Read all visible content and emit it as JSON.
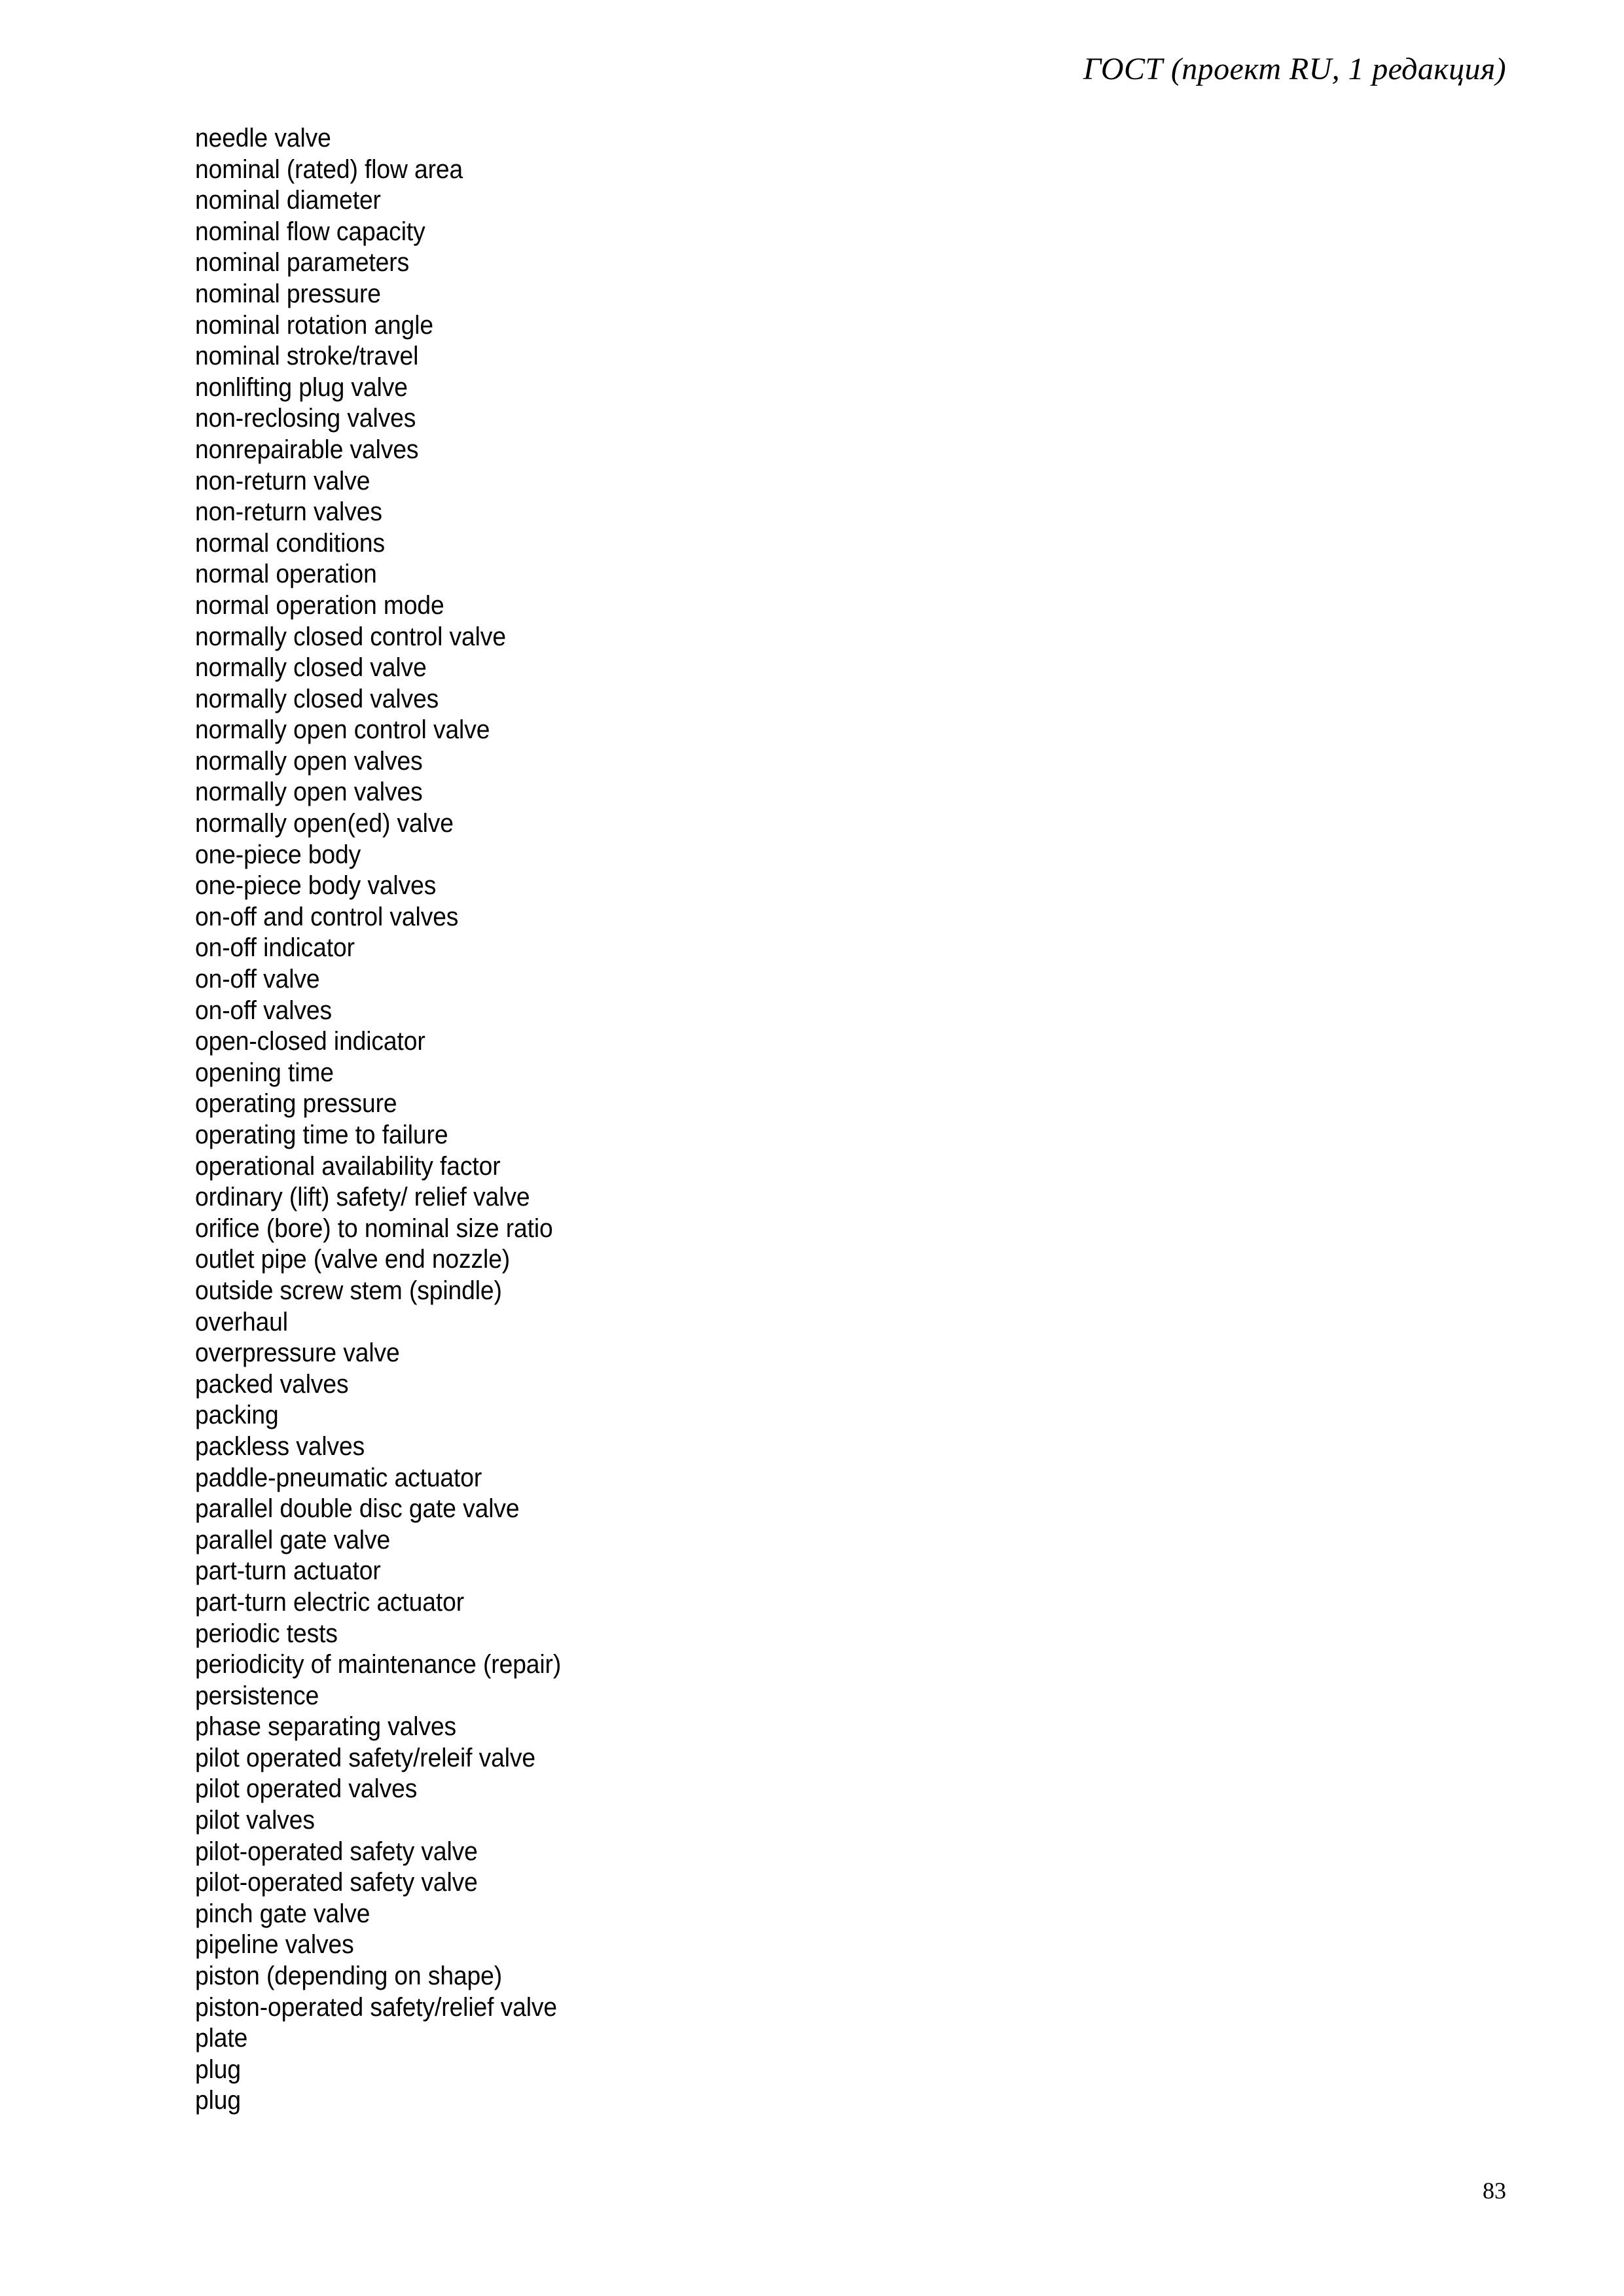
{
  "document": {
    "header_text": "ГОСТ  (проект RU, 1 редакция)",
    "page_number": "83"
  },
  "glossary": {
    "terms": [
      "needle valve",
      "nominal (rated) flow area",
      "nominal diameter",
      "nominal flow capacity",
      "nominal parameters",
      "nominal pressure",
      "nominal rotation angle",
      "nominal stroke/travel",
      "nonlifting plug valve",
      "non-reclosing valves",
      "nonrepairable valves",
      "non-return valve",
      "non-return valves",
      "normal conditions",
      "normal operation",
      "normal operation mode",
      "normally closed control valve",
      "normally closed valve",
      "normally closed valves",
      "normally open control valve",
      "normally open valves",
      "normally open valves",
      "normally open(ed) valve",
      "one-piece body",
      "one-piece body valves",
      "on-off and control valves",
      "on-off indicator",
      "on-off valve",
      "on-off valves",
      "open-closed indicator",
      "opening time",
      "operating pressure",
      "operating time to failure",
      "operational availability factor",
      "ordinary (lift) safety/ relief valve",
      "orifice (bore) to nominal size ratio",
      "outlet pipe (valve end nozzle)",
      "outside screw stem (spindle)",
      "overhaul",
      "overpressure valve",
      "packed valves",
      "packing",
      "packless valves",
      "paddle-pneumatic actuator",
      "parallel double disc gate valve",
      "parallel gate valve",
      "part-turn actuator",
      "part-turn electric actuator",
      "periodic tests",
      "periodicity of maintenance (repair)",
      "persistence",
      "phase separating valves",
      "pilot operated safety/releif valve",
      "pilot operated valves",
      "pilot valves",
      "pilot-operated safety valve",
      "pilot-operated safety valve",
      "pinch gate valve",
      "pipeline valves",
      "piston (depending on shape)",
      "piston-operated safety/relief valve",
      "plate",
      "plug",
      "plug"
    ]
  }
}
